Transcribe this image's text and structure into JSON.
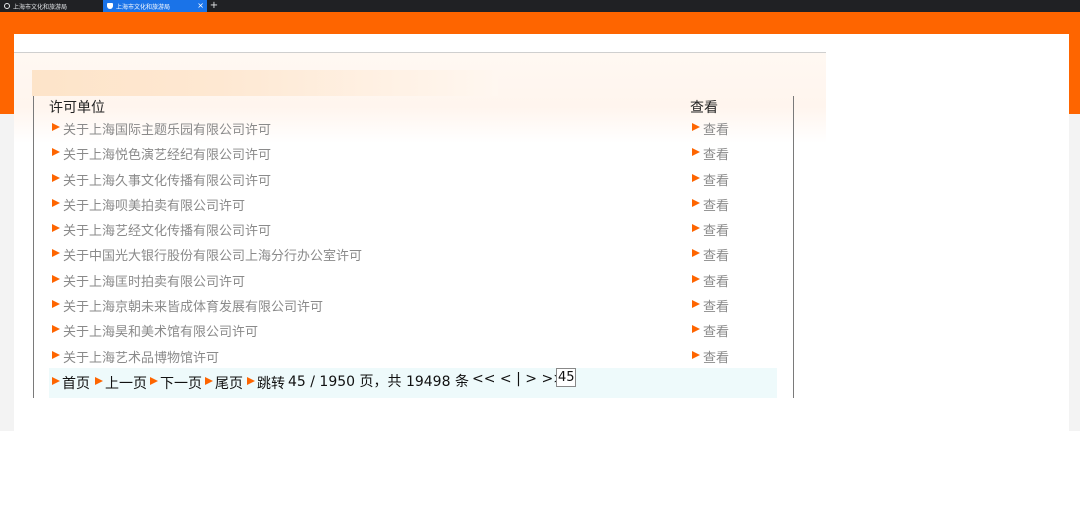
{
  "browser": {
    "tabs": [
      {
        "title": "上海市文化和旅游局",
        "active": false
      },
      {
        "title": "上海市文化和旅游局",
        "active": true
      }
    ],
    "new_tab_label": "+",
    "close_label": "×"
  },
  "colors": {
    "accent": "#fe6500",
    "pager_bg": "#eefafb",
    "link_gray": "#8a8a8a"
  },
  "table": {
    "header": {
      "unit": "许可单位",
      "view": "查看"
    },
    "rows": [
      {
        "title": "关于上海国际主题乐园有限公司许可",
        "view": "查看"
      },
      {
        "title": "关于上海悦色演艺经纪有限公司许可",
        "view": "查看"
      },
      {
        "title": "关于上海久事文化传播有限公司许可",
        "view": "查看"
      },
      {
        "title": "关于上海呗美拍卖有限公司许可",
        "view": "查看"
      },
      {
        "title": "关于上海艺经文化传播有限公司许可",
        "view": "查看"
      },
      {
        "title": "关于中国光大银行股份有限公司上海分行办公室许可",
        "view": "查看"
      },
      {
        "title": "关于上海匡时拍卖有限公司许可",
        "view": "查看"
      },
      {
        "title": "关于上海京朝未来皆成体育发展有限公司许可",
        "view": "查看"
      },
      {
        "title": "关于上海昊和美术馆有限公司许可",
        "view": "查看"
      },
      {
        "title": "关于上海艺术品博物馆许可",
        "view": "查看"
      }
    ]
  },
  "pagination": {
    "first": "首页",
    "prev": "上一页",
    "next": "下一页",
    "last": "尾页",
    "jump": "跳转",
    "info": "45 / 1950 页，共 19498 条",
    "first_arrow": "<<",
    "prev_arrow": "<",
    "separator": "|",
    "next_arrow": ">",
    "last_arrow": ">>",
    "page_value": "45"
  }
}
